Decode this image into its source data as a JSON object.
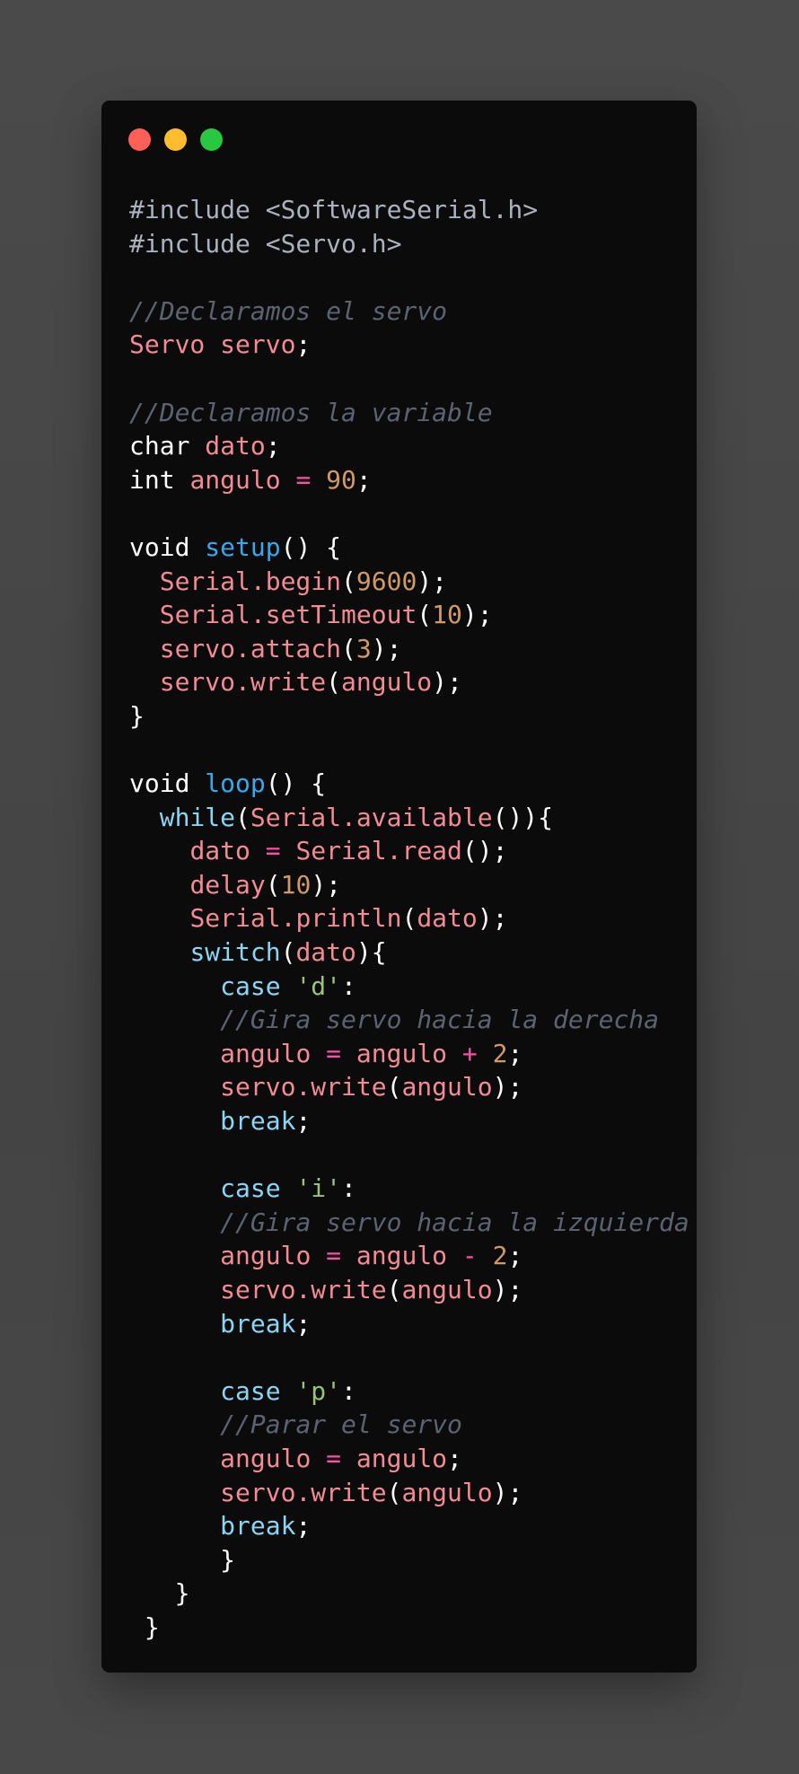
{
  "window": {
    "dots": [
      {
        "name": "close",
        "color": "#ff5f57"
      },
      {
        "name": "minimize",
        "color": "#febc2e"
      },
      {
        "name": "maximize",
        "color": "#28c840"
      }
    ]
  },
  "code": {
    "lines": [
      [
        [
          "pre",
          "#include <SoftwareSerial.h>"
        ]
      ],
      [
        [
          "pre",
          "#include <Servo.h>"
        ]
      ],
      [],
      [
        [
          "com",
          "//Declaramos el servo"
        ]
      ],
      [
        [
          "id",
          "Servo servo"
        ],
        [
          "pun",
          ";"
        ]
      ],
      [],
      [
        [
          "com",
          "//Declaramos la variable"
        ]
      ],
      [
        [
          "kw",
          "char "
        ],
        [
          "id",
          "dato"
        ],
        [
          "pun",
          ";"
        ]
      ],
      [
        [
          "kw",
          "int "
        ],
        [
          "id",
          "angulo "
        ],
        [
          "op",
          "="
        ],
        [
          "pun",
          " "
        ],
        [
          "num",
          "90"
        ],
        [
          "pun",
          ";"
        ]
      ],
      [],
      [
        [
          "kw",
          "void "
        ],
        [
          "fn",
          "setup"
        ],
        [
          "pun",
          "() {"
        ]
      ],
      [
        [
          "pun",
          "  "
        ],
        [
          "id",
          "Serial.begin"
        ],
        [
          "pun",
          "("
        ],
        [
          "num",
          "9600"
        ],
        [
          "pun",
          ");"
        ]
      ],
      [
        [
          "pun",
          "  "
        ],
        [
          "id",
          "Serial.setTimeout"
        ],
        [
          "pun",
          "("
        ],
        [
          "num",
          "10"
        ],
        [
          "pun",
          ");"
        ]
      ],
      [
        [
          "pun",
          "  "
        ],
        [
          "id",
          "servo.attach"
        ],
        [
          "pun",
          "("
        ],
        [
          "num",
          "3"
        ],
        [
          "pun",
          ");"
        ]
      ],
      [
        [
          "pun",
          "  "
        ],
        [
          "id",
          "servo.write"
        ],
        [
          "pun",
          "("
        ],
        [
          "id",
          "angulo"
        ],
        [
          "pun",
          ");"
        ]
      ],
      [
        [
          "pun",
          "}"
        ]
      ],
      [],
      [
        [
          "kw",
          "void "
        ],
        [
          "fn",
          "loop"
        ],
        [
          "pun",
          "() {"
        ]
      ],
      [
        [
          "pun",
          "  "
        ],
        [
          "ctl",
          "while"
        ],
        [
          "pun",
          "("
        ],
        [
          "id",
          "Serial.available"
        ],
        [
          "pun",
          "()){"
        ]
      ],
      [
        [
          "pun",
          "    "
        ],
        [
          "id",
          "dato "
        ],
        [
          "op",
          "="
        ],
        [
          "pun",
          " "
        ],
        [
          "id",
          "Serial.read"
        ],
        [
          "pun",
          "();"
        ]
      ],
      [
        [
          "pun",
          "    "
        ],
        [
          "id",
          "delay"
        ],
        [
          "pun",
          "("
        ],
        [
          "num",
          "10"
        ],
        [
          "pun",
          ");"
        ]
      ],
      [
        [
          "pun",
          "    "
        ],
        [
          "id",
          "Serial.println"
        ],
        [
          "pun",
          "("
        ],
        [
          "id",
          "dato"
        ],
        [
          "pun",
          ");"
        ]
      ],
      [
        [
          "pun",
          "    "
        ],
        [
          "ctl",
          "switch"
        ],
        [
          "pun",
          "("
        ],
        [
          "id",
          "dato"
        ],
        [
          "pun",
          "){"
        ]
      ],
      [
        [
          "pun",
          "      "
        ],
        [
          "ctl",
          "case "
        ],
        [
          "str",
          "'d'"
        ],
        [
          "pun",
          ":"
        ]
      ],
      [
        [
          "pun",
          "      "
        ],
        [
          "com",
          "//Gira servo hacia la derecha"
        ]
      ],
      [
        [
          "pun",
          "      "
        ],
        [
          "id",
          "angulo "
        ],
        [
          "op",
          "="
        ],
        [
          "pun",
          " "
        ],
        [
          "id",
          "angulo "
        ],
        [
          "op",
          "+"
        ],
        [
          "pun",
          " "
        ],
        [
          "num",
          "2"
        ],
        [
          "pun",
          ";"
        ]
      ],
      [
        [
          "pun",
          "      "
        ],
        [
          "id",
          "servo.write"
        ],
        [
          "pun",
          "("
        ],
        [
          "id",
          "angulo"
        ],
        [
          "pun",
          ");"
        ]
      ],
      [
        [
          "pun",
          "      "
        ],
        [
          "ctl",
          "break"
        ],
        [
          "pun",
          ";"
        ]
      ],
      [],
      [
        [
          "pun",
          "      "
        ],
        [
          "ctl",
          "case "
        ],
        [
          "str",
          "'i'"
        ],
        [
          "pun",
          ":"
        ]
      ],
      [
        [
          "pun",
          "      "
        ],
        [
          "com",
          "//Gira servo hacia la izquierda"
        ]
      ],
      [
        [
          "pun",
          "      "
        ],
        [
          "id",
          "angulo "
        ],
        [
          "op",
          "="
        ],
        [
          "pun",
          " "
        ],
        [
          "id",
          "angulo "
        ],
        [
          "op",
          "-"
        ],
        [
          "pun",
          " "
        ],
        [
          "num",
          "2"
        ],
        [
          "pun",
          ";"
        ]
      ],
      [
        [
          "pun",
          "      "
        ],
        [
          "id",
          "servo.write"
        ],
        [
          "pun",
          "("
        ],
        [
          "id",
          "angulo"
        ],
        [
          "pun",
          ");"
        ]
      ],
      [
        [
          "pun",
          "      "
        ],
        [
          "ctl",
          "break"
        ],
        [
          "pun",
          ";"
        ]
      ],
      [],
      [
        [
          "pun",
          "      "
        ],
        [
          "ctl",
          "case "
        ],
        [
          "str",
          "'p'"
        ],
        [
          "pun",
          ":"
        ]
      ],
      [
        [
          "pun",
          "      "
        ],
        [
          "com",
          "//Parar el servo"
        ]
      ],
      [
        [
          "pun",
          "      "
        ],
        [
          "id",
          "angulo "
        ],
        [
          "op",
          "="
        ],
        [
          "pun",
          " "
        ],
        [
          "id",
          "angulo"
        ],
        [
          "pun",
          ";"
        ]
      ],
      [
        [
          "pun",
          "      "
        ],
        [
          "id",
          "servo.write"
        ],
        [
          "pun",
          "("
        ],
        [
          "id",
          "angulo"
        ],
        [
          "pun",
          ");"
        ]
      ],
      [
        [
          "pun",
          "      "
        ],
        [
          "ctl",
          "break"
        ],
        [
          "pun",
          ";"
        ]
      ],
      [
        [
          "pun",
          "      }"
        ]
      ],
      [
        [
          "pun",
          "   }"
        ]
      ],
      [
        [
          "pun",
          " }"
        ]
      ]
    ]
  }
}
